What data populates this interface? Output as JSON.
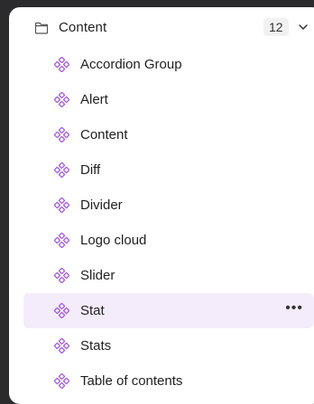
{
  "group": {
    "title": "Content",
    "count": "12",
    "folder_icon": "folder-icon",
    "toggle_icon": "chevron-down-icon"
  },
  "items": [
    {
      "label": "Accordion Group"
    },
    {
      "label": "Alert"
    },
    {
      "label": "Content"
    },
    {
      "label": "Diff"
    },
    {
      "label": "Divider"
    },
    {
      "label": "Logo cloud"
    },
    {
      "label": "Slider"
    },
    {
      "label": "Stat",
      "more": "•••"
    },
    {
      "label": "Stats"
    },
    {
      "label": "Table of contents"
    }
  ],
  "selected_index": 7,
  "colors": {
    "accent": "#a45ddb",
    "selected_bg": "#f5ecfb",
    "window_bg": "#2b2b2d"
  },
  "component_icon": "component-diamond-icon"
}
